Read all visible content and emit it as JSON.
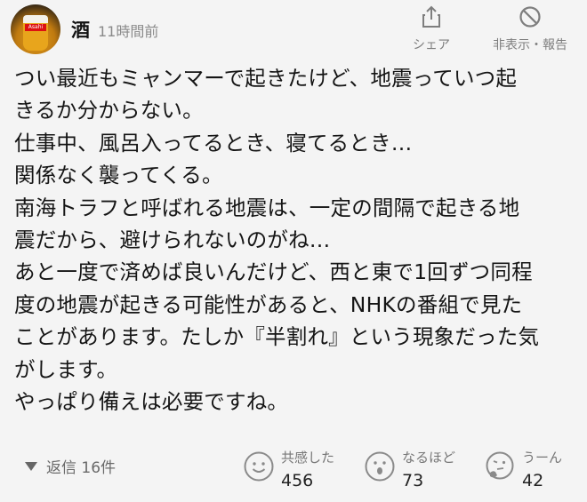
{
  "post": {
    "username": "酒",
    "timestamp": "11時間前",
    "avatar_logo": "Asahi",
    "actions": {
      "share_label": "シェア",
      "hide_label": "非表示・報告"
    },
    "lines": [
      "つい最近もミャンマーで起きたけど、地震っていつ起",
      "きるか分からない。",
      "仕事中、風呂入ってるとき、寝てるとき…",
      "関係なく襲ってくる。",
      "南海トラフと呼ばれる地震は、一定の間隔で起きる地",
      "震だから、避けられないのがね…",
      "あと一度で済めば良いんだけど、西と東で1回ずつ同程",
      "度の地震が起きる可能性があると、NHKの番組で見た",
      "ことがあります。たしか『半割れ』という現象だった気",
      "がします。",
      "やっぱり備えは必要ですね。"
    ]
  },
  "footer": {
    "replies_label": "返信 16件",
    "reactions": [
      {
        "label": "共感した",
        "count": "456",
        "icon": "smile-face-icon"
      },
      {
        "label": "なるほど",
        "count": "73",
        "icon": "surprised-face-icon"
      },
      {
        "label": "うーん",
        "count": "42",
        "icon": "thinking-face-icon"
      }
    ]
  }
}
